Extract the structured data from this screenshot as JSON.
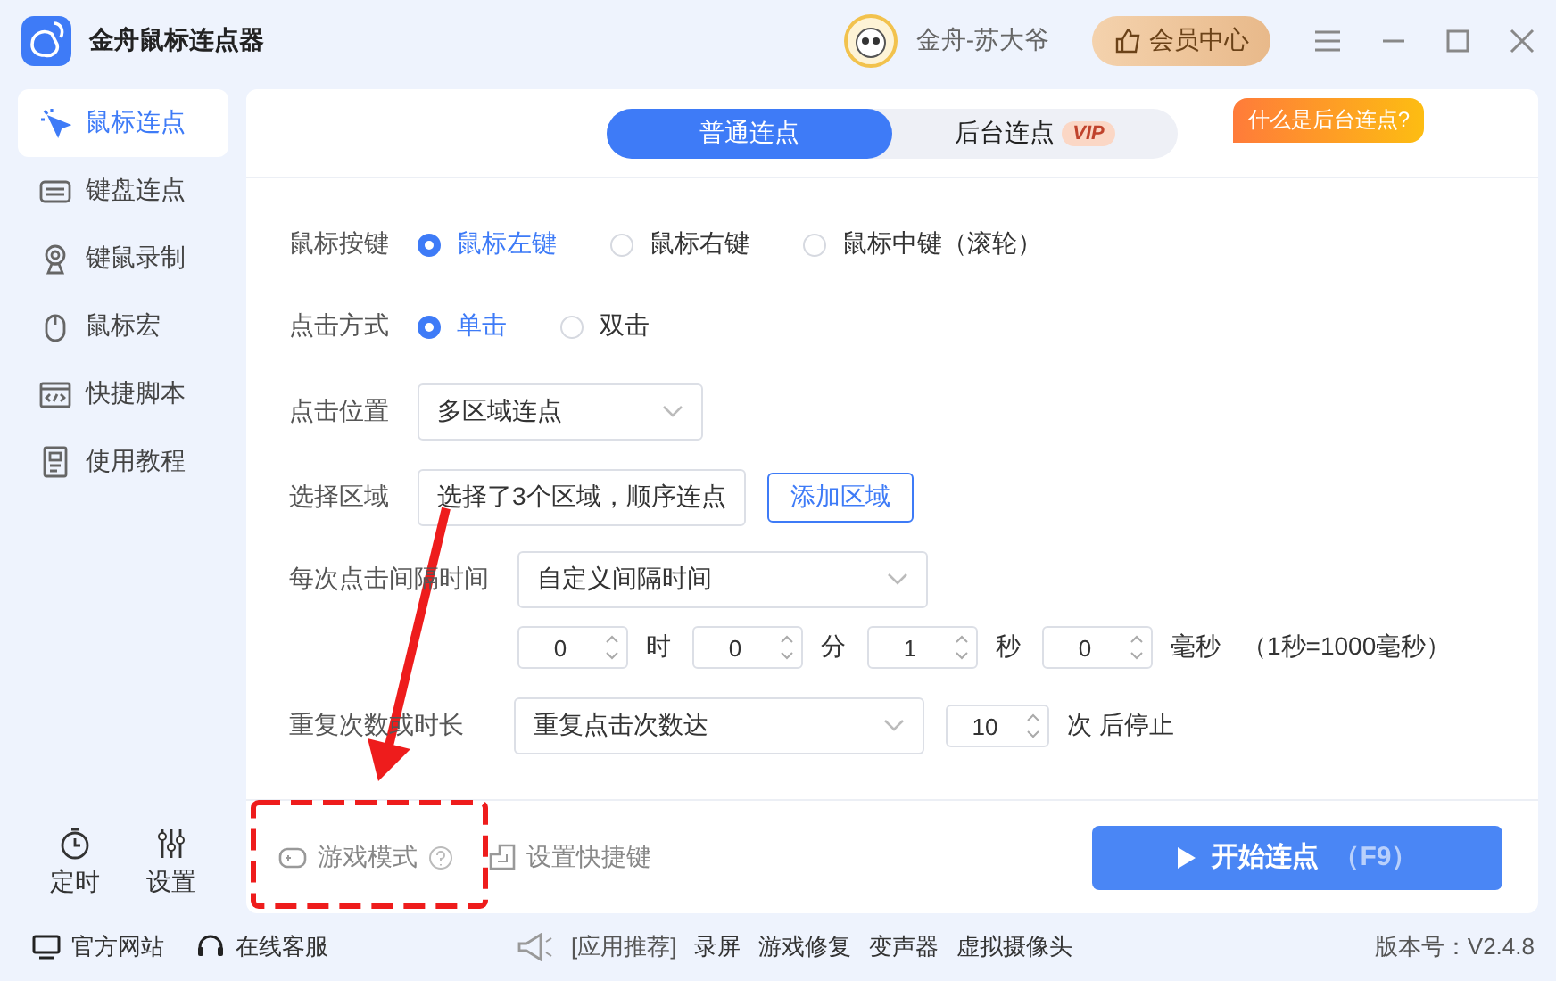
{
  "app": {
    "title": "金舟鼠标连点器"
  },
  "user": {
    "name": "金舟-苏大爷"
  },
  "vip_button": {
    "label": "会员中心"
  },
  "sidebar": {
    "items": [
      {
        "label": "鼠标连点",
        "selected": true,
        "kind": "click"
      },
      {
        "label": "键盘连点",
        "selected": false,
        "kind": "keyboard"
      },
      {
        "label": "键鼠录制",
        "selected": false,
        "kind": "camera"
      },
      {
        "label": "鼠标宏",
        "selected": false,
        "kind": "mouse"
      },
      {
        "label": "快捷脚本",
        "selected": false,
        "kind": "code"
      },
      {
        "label": "使用教程",
        "selected": false,
        "kind": "doc"
      }
    ],
    "tools": [
      {
        "label": "定时",
        "kind": "timer"
      },
      {
        "label": "设置",
        "kind": "sliders"
      }
    ]
  },
  "tabs": [
    {
      "label": "普通连点",
      "selected": true
    },
    {
      "label": "后台连点",
      "selected": false,
      "badge": "VIP"
    }
  ],
  "help_tag": "什么是后台连点?",
  "form": {
    "mouse_button": {
      "label": "鼠标按键",
      "options": [
        {
          "label": "鼠标左键",
          "selected": true
        },
        {
          "label": "鼠标右键",
          "selected": false
        },
        {
          "label": "鼠标中键（滚轮）",
          "selected": false
        }
      ]
    },
    "click_type": {
      "label": "点击方式",
      "options": [
        {
          "label": "单击",
          "selected": true
        },
        {
          "label": "双击",
          "selected": false
        }
      ]
    },
    "click_position": {
      "label": "点击位置",
      "value": "多区域连点"
    },
    "region": {
      "label": "选择区域",
      "value": "选择了3个区域，顺序连点",
      "button": "添加区域"
    },
    "interval": {
      "label": "每次点击间隔时间",
      "value": "自定义间隔时间",
      "fields": [
        {
          "value": "0",
          "unit": "时"
        },
        {
          "value": "0",
          "unit": "分"
        },
        {
          "value": "1",
          "unit": "秒"
        },
        {
          "value": "0",
          "unit": "毫秒"
        }
      ],
      "note": "（1秒=1000毫秒）"
    },
    "repeat": {
      "label": "重复次数或时长",
      "value": "重复点击次数达",
      "count": "10",
      "suffix": "次 后停止"
    }
  },
  "footer": {
    "game_mode": "游戏模式",
    "shortcut": "设置快捷键",
    "start_button": {
      "label": "开始连点",
      "hotkey": "（F9）"
    }
  },
  "status_bar": {
    "links": [
      {
        "label": "官方网站",
        "kind": "monitor"
      },
      {
        "label": "在线客服",
        "kind": "headset"
      }
    ],
    "promo_label": "[应用推荐]",
    "promo_links": [
      "录屏",
      "游戏修复",
      "变声器",
      "虚拟摄像头"
    ],
    "version": "版本号：V2.4.8"
  }
}
